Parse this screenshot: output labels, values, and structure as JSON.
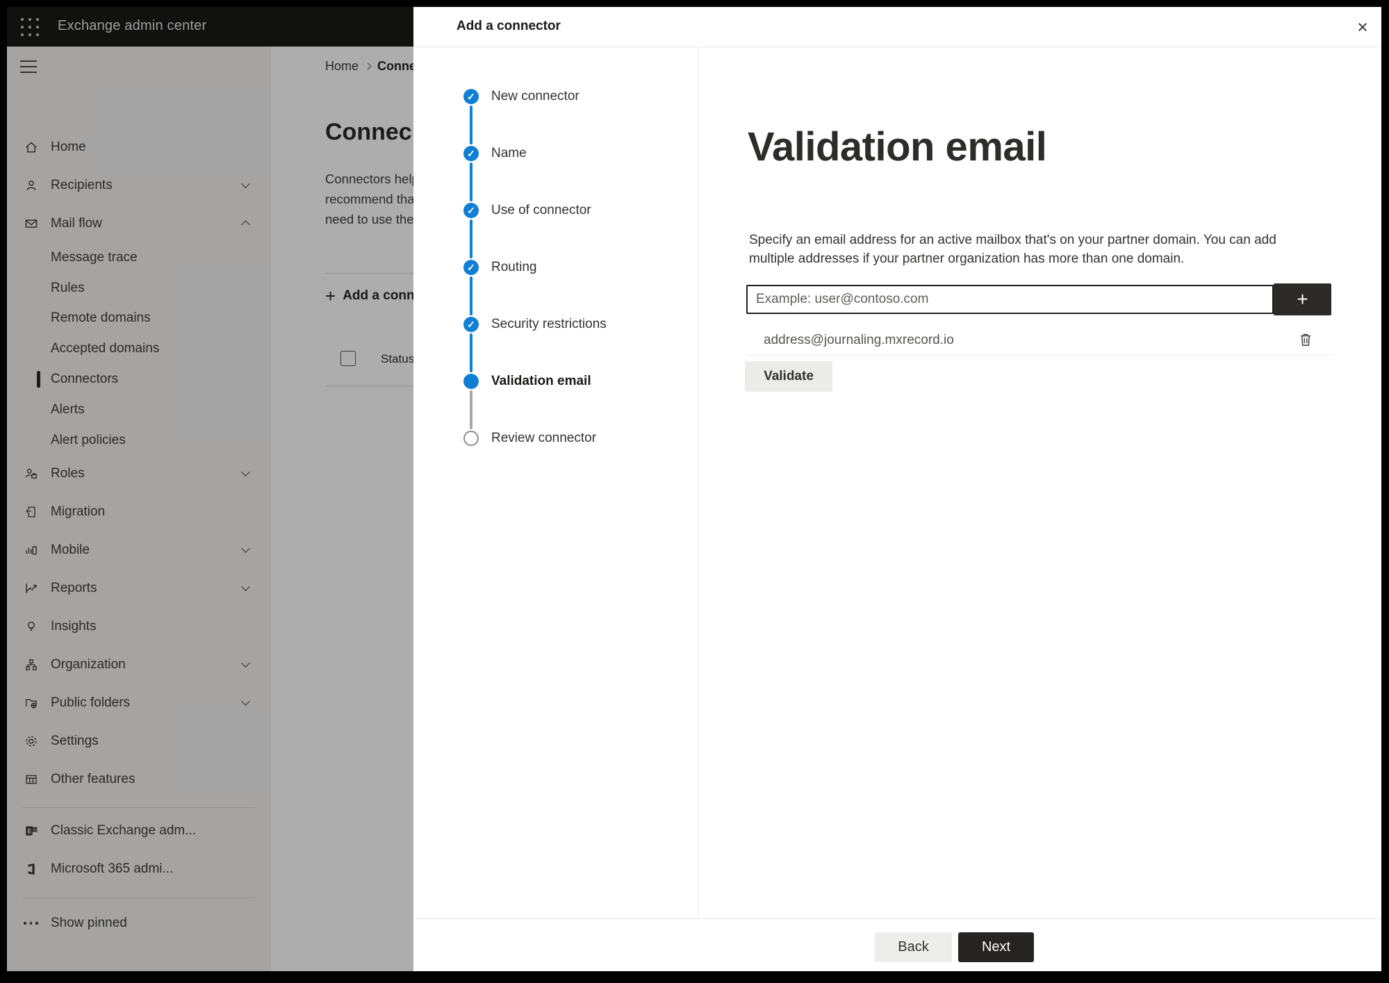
{
  "topbar": {
    "title": "Exchange admin center"
  },
  "sidebar": {
    "items": [
      {
        "label": "Home",
        "icon": "home-icon"
      },
      {
        "label": "Recipients",
        "icon": "person-icon",
        "chevron": "down"
      },
      {
        "label": "Mail flow",
        "icon": "mail-icon",
        "chevron": "up",
        "expanded": true
      },
      {
        "label": "Message trace",
        "type": "sub"
      },
      {
        "label": "Rules",
        "type": "sub"
      },
      {
        "label": "Remote domains",
        "type": "sub"
      },
      {
        "label": "Accepted domains",
        "type": "sub"
      },
      {
        "label": "Connectors",
        "type": "sub",
        "selected": true
      },
      {
        "label": "Alerts",
        "type": "sub"
      },
      {
        "label": "Alert policies",
        "type": "sub"
      },
      {
        "label": "Roles",
        "icon": "roles-icon",
        "chevron": "down"
      },
      {
        "label": "Migration",
        "icon": "migration-icon"
      },
      {
        "label": "Mobile",
        "icon": "mobile-icon",
        "chevron": "down"
      },
      {
        "label": "Reports",
        "icon": "reports-icon",
        "chevron": "down"
      },
      {
        "label": "Insights",
        "icon": "insights-icon"
      },
      {
        "label": "Organization",
        "icon": "organization-icon",
        "chevron": "down"
      },
      {
        "label": "Public folders",
        "icon": "public-folders-icon",
        "chevron": "down"
      },
      {
        "label": "Settings",
        "icon": "settings-icon"
      },
      {
        "label": "Other features",
        "icon": "other-features-icon"
      },
      {
        "label": "Classic Exchange adm...",
        "icon": "classic-exchange-icon"
      },
      {
        "label": "Microsoft 365 admi...",
        "icon": "microsoft-365-icon"
      },
      {
        "label": "Show pinned",
        "icon": "ellipsis-icon"
      }
    ]
  },
  "background": {
    "breadcrumb": {
      "home": "Home",
      "current": "Conne"
    },
    "page_heading": "Connec",
    "intro_lines": [
      "Connectors help",
      "recommend that",
      "need to use ther"
    ],
    "add_connector_label": "Add a conn",
    "status_header": "Status"
  },
  "panel": {
    "title": "Add a connector",
    "close_glyph": "×",
    "steps": [
      {
        "label": "New connector",
        "state": "completed"
      },
      {
        "label": "Name",
        "state": "completed"
      },
      {
        "label": "Use of connector",
        "state": "completed"
      },
      {
        "label": "Routing",
        "state": "completed"
      },
      {
        "label": "Security restrictions",
        "state": "completed"
      },
      {
        "label": "Validation email",
        "state": "current"
      },
      {
        "label": "Review connector",
        "state": "upcoming"
      }
    ],
    "check_glyph": "✓",
    "content": {
      "heading": "Validation email",
      "description_lines": [
        "Specify an email address for an active mailbox that's on your partner domain. You can add",
        "multiple addresses if your partner organization has more than one domain."
      ],
      "input_placeholder": "Example: user@contoso.com",
      "add_glyph": "+",
      "addresses": [
        "address@journaling.mxrecord.io"
      ],
      "validate_label": "Validate"
    },
    "footer": {
      "back_label": "Back",
      "next_label": "Next"
    }
  },
  "colors": {
    "accent_blue": "#0f7ed5",
    "topbar_bg": "#1a1a19",
    "primary_button_bg": "#252423"
  }
}
